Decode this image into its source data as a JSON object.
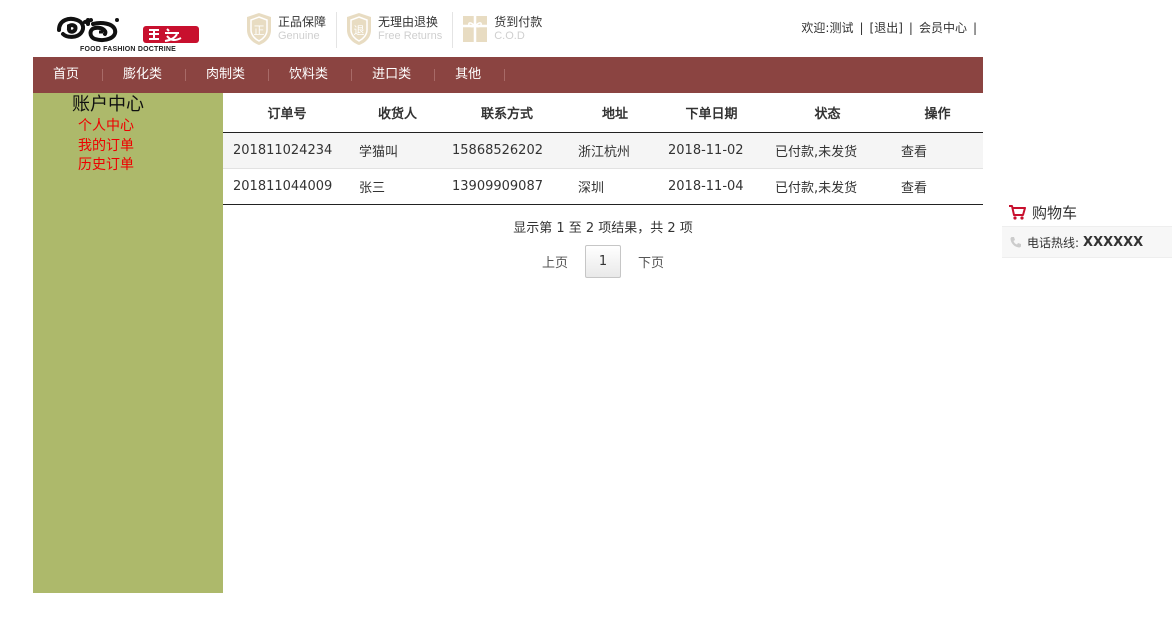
{
  "header": {
    "logo_tagline": "FOOD FASHION DOCTRINE",
    "promises": [
      {
        "icon": "genuine-icon",
        "cn": "正品保障",
        "en": "Genuine"
      },
      {
        "icon": "returns-icon",
        "cn": "无理由退换",
        "en": "Free Returns"
      },
      {
        "icon": "gift-icon",
        "cn": "货到付款",
        "en": "C.O.D"
      }
    ],
    "welcome": "欢迎:测试",
    "logout": "[退出]",
    "member_center": "会员中心",
    "separator": "|"
  },
  "nav": {
    "items": [
      "首页",
      "膨化类",
      "肉制类",
      "饮料类",
      "进口类",
      "其他"
    ]
  },
  "sidebar": {
    "title": "账户中心",
    "links": [
      "个人中心",
      "我的订单",
      "历史订单"
    ]
  },
  "orders": {
    "columns": [
      "订单号",
      "收货人",
      "联系方式",
      "地址",
      "下单日期",
      "状态",
      "操作"
    ],
    "rows": [
      {
        "order_no": "201811024234",
        "receiver": "学猫叫",
        "phone": "15868526202",
        "address": "浙江杭州",
        "date": "2018-11-02",
        "status": "已付款,未发货",
        "action": "查看"
      },
      {
        "order_no": "201811044009",
        "receiver": "张三",
        "phone": "13909909087",
        "address": "深圳",
        "date": "2018-11-04",
        "status": "已付款,未发货",
        "action": "查看"
      }
    ],
    "result_info": "显示第 1 至 2 项结果，共 2 项"
  },
  "pagination": {
    "prev": "上页",
    "current": "1",
    "next": "下页"
  },
  "floating": {
    "cart_label": "购物车",
    "hotline_label": "电话热线:",
    "hotline_number": "XXXXXX"
  },
  "colors": {
    "nav_bg": "#8b4441",
    "sidebar_bg": "#adb96b",
    "sidebar_link": "#ee0000",
    "logo_red": "#c8102e"
  }
}
